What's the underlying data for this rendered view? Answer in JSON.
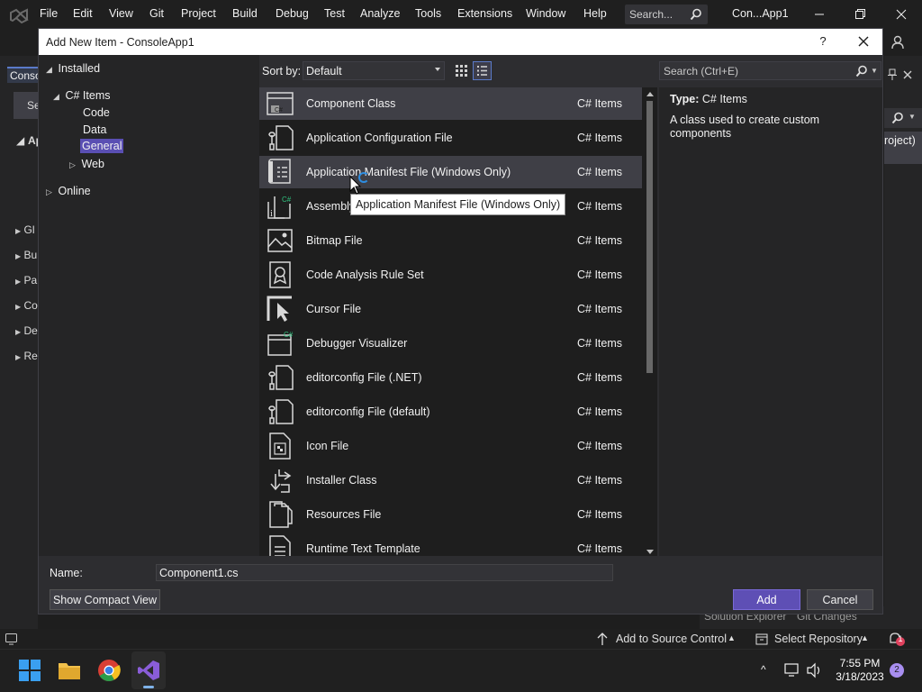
{
  "vs": {
    "menu": [
      "File",
      "Edit",
      "View",
      "Git",
      "Project",
      "Build",
      "Debug",
      "Test",
      "Analyze",
      "Tools",
      "Extensions",
      "Window",
      "Help"
    ],
    "search_placeholder": "Search...",
    "app_title": "Con...App1",
    "left_partial": [
      "Conso",
      "Se",
      "Ap",
      "Gl",
      "Bu",
      "Pa",
      "Co",
      "De",
      "Re"
    ],
    "right_partial": "roject)",
    "behind_tabs": [
      "Solution Explorer",
      "Git Changes"
    ]
  },
  "status": {
    "source_control": "Add to Source Control",
    "repository": "Select Repository",
    "notifications": "1"
  },
  "taskbar": {
    "time": "7:55 PM",
    "date": "3/18/2023",
    "badge": "2"
  },
  "dialog": {
    "title": "Add New Item - ConsoleApp1",
    "help": "?",
    "tree": {
      "installed": "Installed",
      "csharp_items": "C# Items",
      "code": "Code",
      "data": "Data",
      "general": "General",
      "web": "Web",
      "online": "Online"
    },
    "sort_label": "Sort by:",
    "sort_value": "Default",
    "search_placeholder": "Search (Ctrl+E)",
    "templates": [
      {
        "name": "Component Class",
        "type": "C# Items",
        "icon": "component-class-icon"
      },
      {
        "name": "Application Configuration File",
        "type": "C# Items",
        "icon": "config-file-icon"
      },
      {
        "name": "Application Manifest File (Windows Only)",
        "type": "C# Items",
        "icon": "manifest-file-icon"
      },
      {
        "name": "Assembly Information File",
        "type": "C# Items",
        "icon": "assembly-info-icon"
      },
      {
        "name": "Bitmap File",
        "type": "C# Items",
        "icon": "bitmap-file-icon"
      },
      {
        "name": "Code Analysis Rule Set",
        "type": "C# Items",
        "icon": "rule-set-icon"
      },
      {
        "name": "Cursor File",
        "type": "C# Items",
        "icon": "cursor-file-icon"
      },
      {
        "name": "Debugger Visualizer",
        "type": "C# Items",
        "icon": "debugger-visualizer-icon"
      },
      {
        "name": "editorconfig File (.NET)",
        "type": "C# Items",
        "icon": "editorconfig-icon"
      },
      {
        "name": "editorconfig File (default)",
        "type": "C# Items",
        "icon": "editorconfig-icon"
      },
      {
        "name": "Icon File",
        "type": "C# Items",
        "icon": "icon-file-icon"
      },
      {
        "name": "Installer Class",
        "type": "C# Items",
        "icon": "installer-class-icon"
      },
      {
        "name": "Resources File",
        "type": "C# Items",
        "icon": "resources-file-icon"
      },
      {
        "name": "Runtime Text Template",
        "type": "C# Items",
        "icon": "text-template-icon"
      }
    ],
    "details": {
      "type_label": "Type:",
      "type_value": "C# Items",
      "description": "A class used to create custom components"
    },
    "tooltip": "Application Manifest File (Windows Only)",
    "name_label": "Name:",
    "name_value": "Component1.cs",
    "compact_view": "Show Compact View",
    "add": "Add",
    "cancel": "Cancel"
  },
  "colors": {
    "accent": "#5e4fb5",
    "selection": "#3f3f46",
    "background": "#1e1e1e"
  }
}
